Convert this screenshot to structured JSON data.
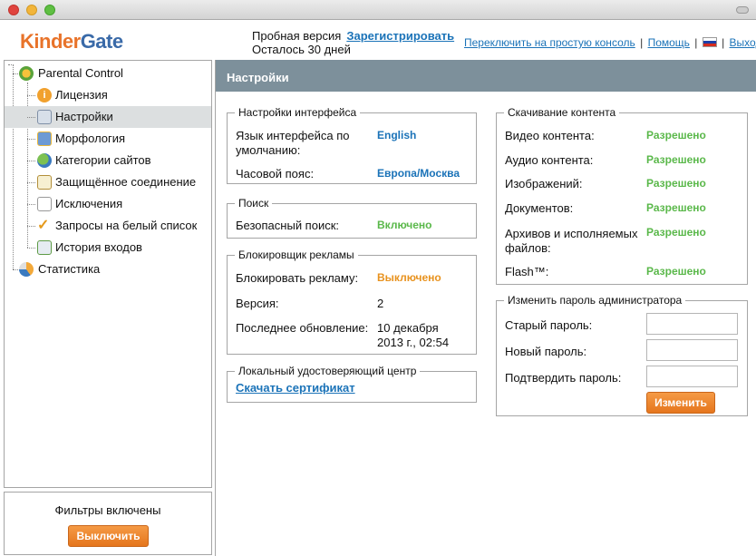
{
  "header": {
    "logo_part1": "Kinder",
    "logo_part2": "Gate",
    "trial_label": "Пробная версия",
    "register_link": "Зарегистрировать",
    "days_left": "Осталось 30 дней",
    "switch_console": "Переключить на простую консоль",
    "help": "Помощь",
    "logout": "Выход",
    "separator": "|"
  },
  "sidebar": {
    "root": "Parental Control",
    "items": [
      {
        "label": "Лицензия",
        "icon": "info-icon"
      },
      {
        "label": "Настройки",
        "icon": "settings-icon"
      },
      {
        "label": "Морфология",
        "icon": "morphology-icon"
      },
      {
        "label": "Категории сайтов",
        "icon": "categories-icon"
      },
      {
        "label": "Защищённое соединение",
        "icon": "secure-connection-icon"
      },
      {
        "label": "Исключения",
        "icon": "exceptions-icon"
      },
      {
        "label": "Запросы на белый список",
        "icon": "checkmark-icon"
      },
      {
        "label": "История входов",
        "icon": "history-icon"
      }
    ],
    "stats": "Статистика",
    "filters_status": "Фильтры включены",
    "disable_button": "Выключить"
  },
  "main": {
    "title": "Настройки",
    "interface": {
      "legend": "Настройки интерфейса",
      "lang_label_1": "Язык интерфейса по",
      "lang_label_2": "умолчанию:",
      "lang_value": "English",
      "tz_label": "Часовой пояс:",
      "tz_value": "Европа/Москва"
    },
    "search": {
      "legend": "Поиск",
      "safe_label": "Безопасный поиск:",
      "safe_value": "Включено"
    },
    "adblock": {
      "legend": "Блокировщик рекламы",
      "block_label": "Блокировать рекламу:",
      "block_value": "Выключено",
      "version_label": "Версия:",
      "version_value": "2",
      "update_label": "Последнее обновление:",
      "update_value_1": "10 декабря",
      "update_value_2": "2013 г., 02:54"
    },
    "ca": {
      "legend": "Локальный удостоверяющий центр",
      "download_link": "Скачать сертификат"
    },
    "download": {
      "legend": "Скачивание контента",
      "rows": [
        {
          "label": "Видео контента:",
          "value": "Разрешено"
        },
        {
          "label": "Аудио контента:",
          "value": "Разрешено"
        },
        {
          "label": "Изображений:",
          "value": "Разрешено"
        },
        {
          "label": "Документов:",
          "value": "Разрешено"
        },
        {
          "label": "Архивов и исполняемых",
          "label2": "файлов:",
          "value": "Разрешено"
        },
        {
          "label": "Flash™:",
          "value": "Разрешено"
        }
      ]
    },
    "password": {
      "legend": "Изменить пароль администратора",
      "old_label": "Старый пароль:",
      "new_label": "Новый пароль:",
      "confirm_label": "Подтвердить пароль:",
      "change_button": "Изменить"
    }
  },
  "colors": {
    "accent_orange": "#e8732a",
    "link_blue": "#1b73b8",
    "status_green": "#5ab84a",
    "header_bar": "#7d909b"
  }
}
